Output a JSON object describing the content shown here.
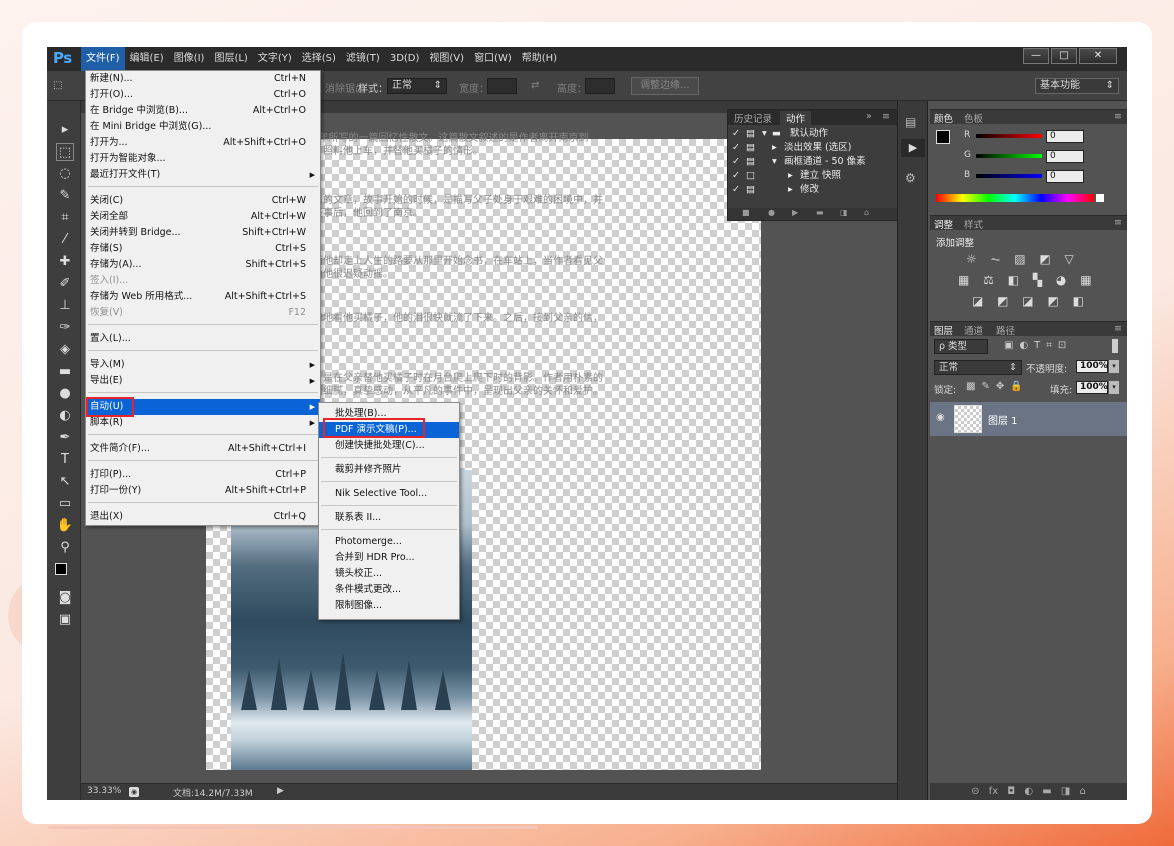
{
  "app": {
    "logo": "Ps",
    "menu": [
      "文件(F)",
      "编辑(E)",
      "图像(I)",
      "图层(L)",
      "文字(Y)",
      "选择(S)",
      "滤镜(T)",
      "3D(D)",
      "视图(V)",
      "窗口(W)",
      "帮助(H)"
    ],
    "window_controls": [
      "—",
      "□",
      "✕"
    ]
  },
  "options_bar": {
    "antialias": "消除锯齿",
    "style_label": "样式：",
    "style_value": "正常",
    "width_label": "宽度：",
    "swap": "⇄",
    "height_label": "高度：",
    "refine_edge": "调整边缘...",
    "workspace": "基本功能"
  },
  "file_menu": {
    "items": [
      {
        "label": "新建(N)...",
        "shortcut": "Ctrl+N"
      },
      {
        "label": "打开(O)...",
        "shortcut": "Ctrl+O"
      },
      {
        "label": "在 Bridge 中浏览(B)...",
        "shortcut": "Alt+Ctrl+O"
      },
      {
        "label": "在 Mini Bridge 中浏览(G)...",
        "shortcut": ""
      },
      {
        "label": "打开为...",
        "shortcut": "Alt+Shift+Ctrl+O"
      },
      {
        "label": "打开为智能对象...",
        "shortcut": ""
      },
      {
        "label": "最近打开文件(T)",
        "shortcut": ""
      },
      {
        "label": "关闭(C)",
        "shortcut": "Ctrl+W"
      },
      {
        "label": "关闭全部",
        "shortcut": "Alt+Ctrl+W"
      },
      {
        "label": "关闭并转到 Bridge...",
        "shortcut": "Shift+Ctrl+W"
      },
      {
        "label": "存储(S)",
        "shortcut": "Ctrl+S"
      },
      {
        "label": "存储为(A)...",
        "shortcut": "Shift+Ctrl+S"
      },
      {
        "label": "签入(I)...",
        "shortcut": ""
      },
      {
        "label": "存储为 Web 所用格式...",
        "shortcut": "Alt+Shift+Ctrl+S"
      },
      {
        "label": "恢复(V)",
        "shortcut": "F12"
      },
      {
        "label": "置入(L)...",
        "shortcut": ""
      },
      {
        "label": "导入(M)",
        "shortcut": ""
      },
      {
        "label": "导出(E)",
        "shortcut": ""
      },
      {
        "label": "自动(U)",
        "shortcut": ""
      },
      {
        "label": "脚本(R)",
        "shortcut": ""
      },
      {
        "label": "文件简介(F)...",
        "shortcut": "Alt+Shift+Ctrl+I"
      },
      {
        "label": "打印(P)...",
        "shortcut": "Ctrl+P"
      },
      {
        "label": "打印一份(Y)",
        "shortcut": "Alt+Shift+Ctrl+P"
      },
      {
        "label": "退出(X)",
        "shortcut": "Ctrl+Q"
      }
    ]
  },
  "automate_menu": {
    "items": [
      "批处理(B)...",
      "PDF 演示文稿(P)...",
      "创建快捷批处理(C)...",
      "裁剪并修齐照片",
      "Nik Selective Tool...",
      "联系表 II...",
      "Photomerge...",
      "合并到 HDR Pro...",
      "镜头校正...",
      "条件模式更改...",
      "限制图像..."
    ]
  },
  "history_panel": {
    "tabs": [
      "历史记录",
      "动作"
    ],
    "rows": [
      "默认动作",
      "淡出效果 (选区)",
      "画框通道 - 50 像素",
      "建立 快照",
      "修改"
    ]
  },
  "canvas": {
    "text_lines": [
      "《背影》是现代作家朱自清于1925年所写的一篇回忆性散文。这篇散文叙述的是作者离开南京到",
      "北京大学，父亲送他到浦口火车站，照料他上车，并替他买橘子的情形。",
      "",
      "在散文里，作者抒写了父子之间感情的文章，故事开始的时候，是描写父子处身于艰难的困境中，并开",
      "回家办丧事，父子同回丧办，办完丧事后，他回到了南京。",
      "",
      "他的父亲执着送他进入大学的作，而他却走上人生的路要从那里开始念书，在车站上，当作者看见父亲爬车站",
      "月台时，他看到父亲，渐渐多起认为他很迟疑动摇。",
      "",
      "作者看着父亲背影的时候是那么真挚地看他买橘子，他的泪很快就流了下来。之后，接到父亲的信，念他是赴",
      "",
      "",
      "这篇散文的文字及语言是很朴素的，是在父亲替他买橘子时在月台爬上爬下时的背影。作者用朴素的文",
      "字，把父亲对儿子的爱，表达得深刻细腻，真挚感动，从平凡的事件中，呈现出父亲的关怀和爱护。"
    ]
  },
  "status_bar": {
    "zoom": "33.33%",
    "doc": "文档:14.2M/7.33M"
  },
  "color_panel": {
    "tabs": [
      "颜色",
      "色板"
    ],
    "channels": [
      {
        "name": "R",
        "value": "0"
      },
      {
        "name": "G",
        "value": "0"
      },
      {
        "name": "B",
        "value": "0"
      }
    ]
  },
  "adjust_panel": {
    "tabs": [
      "调整",
      "样式"
    ],
    "title": "添加调整",
    "icons": [
      "☼ ⏦ ▨ ◩ ▽",
      "▦ ⚖ ◧ ▚ ◕ ▦",
      "◪ ◩ ◪ ◩ ◧"
    ]
  },
  "layers_panel": {
    "tabs": [
      "图层",
      "通道",
      "路径"
    ],
    "kind": "ρ 类型",
    "blend": "正常",
    "opacity_label": "不透明度:",
    "opacity": "100%",
    "lock_label": "锁定:",
    "fill_label": "填充:",
    "fill": "100%",
    "layer_name": "图层 1",
    "bottom_icons": "⊝ fx ◘ ◐ ▬ ◨ ⌂"
  },
  "colors": {
    "accent": "#0a64d6",
    "highlight_box": "#e8242b",
    "panel": "#535353"
  }
}
